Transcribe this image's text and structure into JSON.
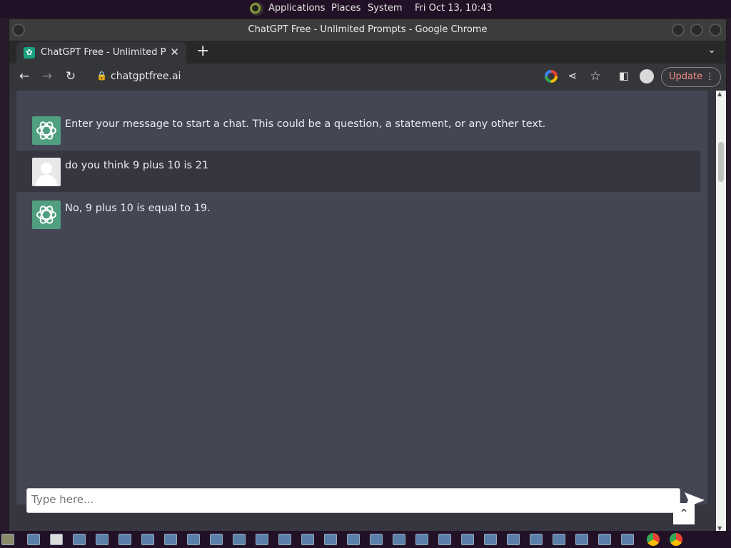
{
  "system_bar": {
    "menus": [
      "Applications",
      "Places",
      "System"
    ],
    "clock": "Fri Oct 13, 10:43"
  },
  "window": {
    "title": "ChatGPT Free - Unlimited Prompts - Google Chrome"
  },
  "tab": {
    "title": "ChatGPT Free - Unlimited Prompts",
    "favicon": "chatgpt-logo-icon"
  },
  "toolbar": {
    "url": "chatgptfree.ai",
    "update_label": "Update",
    "icons": [
      "back-icon",
      "forward-icon",
      "reload-icon",
      "lock-icon",
      "google-icon",
      "share-icon",
      "star-icon",
      "sidepanel-icon",
      "profile-icon",
      "menu-icon"
    ]
  },
  "chat": {
    "messages": [
      {
        "role": "bot",
        "text": "Enter your message to start a chat. This could be a question, a statement, or any other text."
      },
      {
        "role": "user",
        "text": "do you think 9 plus 10 is 21"
      },
      {
        "role": "bot",
        "text": "No, 9 plus 10 is equal to 19."
      }
    ],
    "input_placeholder": "Type here..."
  },
  "colors": {
    "bot_avatar": "#4f9f80",
    "panel": "#444654",
    "user_row": "#353640",
    "update_text": "#f28b82"
  }
}
